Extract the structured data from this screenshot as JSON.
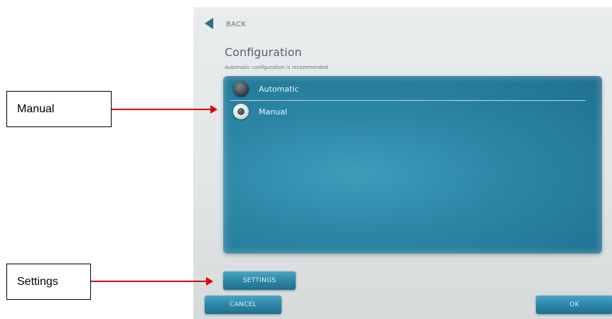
{
  "nav": {
    "back_label": "BACK"
  },
  "header": {
    "title": "Configuration",
    "subtitle": "Automatic configuration is recommended."
  },
  "options": [
    {
      "label": "Automatic",
      "selected": false
    },
    {
      "label": "Manual",
      "selected": true
    }
  ],
  "buttons": {
    "settings_label": "SETTINGS",
    "cancel_label": "CANCEL",
    "ok_label": "OK"
  },
  "annotations": {
    "manual_callout": "Manual",
    "settings_callout": "Settings"
  },
  "colors": {
    "accent": "#2c86a7",
    "arrow": "#e00000"
  }
}
